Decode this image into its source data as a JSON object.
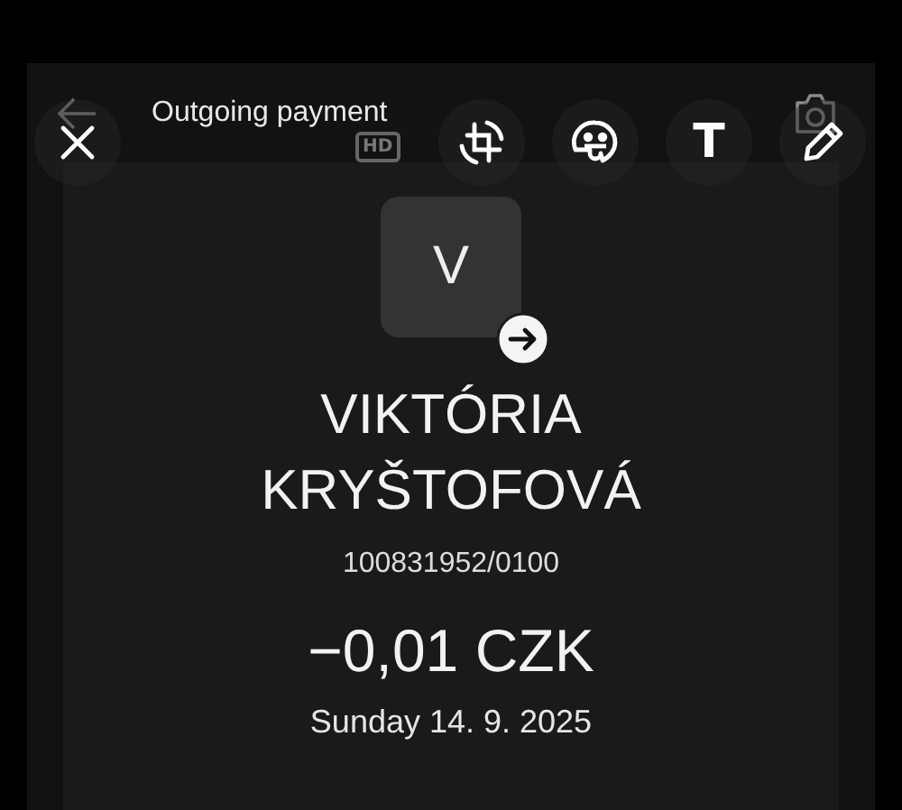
{
  "screenshot": {
    "title": "Outgoing payment",
    "avatar_initial": "V",
    "recipient_name": "VIKTÓRIA KRYŠTOFOVÁ",
    "account_number": "100831952/0100",
    "amount": "−0,01 CZK",
    "date": "Sunday 14. 9. 2025"
  },
  "editor": {
    "hd_label": "HD",
    "tools": [
      {
        "kind": "crop"
      },
      {
        "kind": "sticker"
      },
      {
        "kind": "text",
        "label": "T"
      },
      {
        "kind": "draw"
      }
    ]
  }
}
